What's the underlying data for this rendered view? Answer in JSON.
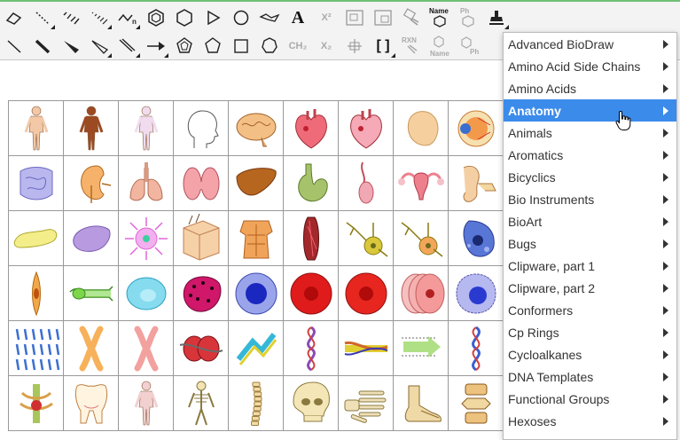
{
  "toolbar": {
    "text_tool": "A",
    "superscript": "X²",
    "subscript": "X₂",
    "ch2_label": "CH₂",
    "brackets_label": "[ ]",
    "rxn_label": "RXN",
    "name_label": "Name",
    "ph_label": "Ph",
    "name_label_2": "Name",
    "ph_label_2": "Ph"
  },
  "template_menu": {
    "items": [
      {
        "label": "Advanced BioDraw"
      },
      {
        "label": "Amino Acid Side Chains"
      },
      {
        "label": "Amino Acids"
      },
      {
        "label": "Anatomy"
      },
      {
        "label": "Animals"
      },
      {
        "label": "Aromatics"
      },
      {
        "label": "Bicyclics"
      },
      {
        "label": "Bio Instruments"
      },
      {
        "label": "BioArt"
      },
      {
        "label": "Bugs"
      },
      {
        "label": "Clipware, part 1"
      },
      {
        "label": "Clipware, part 2"
      },
      {
        "label": "Conformers"
      },
      {
        "label": "Cp Rings"
      },
      {
        "label": "Cycloalkanes"
      },
      {
        "label": "DNA Templates"
      },
      {
        "label": "Functional Groups"
      },
      {
        "label": "Hexoses"
      }
    ],
    "active_index": 3
  },
  "anatomy_grid": {
    "cells": [
      {
        "name": "male-body",
        "shape": "body",
        "color": "#f2c8a6"
      },
      {
        "name": "male-muscle-body",
        "shape": "body",
        "color": "#9b4a22"
      },
      {
        "name": "female-body",
        "shape": "body",
        "color": "#f0dcee"
      },
      {
        "name": "head-outline",
        "shape": "head",
        "color": "#ffffff"
      },
      {
        "name": "brain",
        "shape": "brain",
        "color": "#f4bf84"
      },
      {
        "name": "heart-red",
        "shape": "heart",
        "color": "#ef6b7a"
      },
      {
        "name": "heart-pink",
        "shape": "heart",
        "color": "#f6a9b6"
      },
      {
        "name": "pancreas-organ",
        "shape": "blob",
        "color": "#f5cf9d"
      },
      {
        "name": "eye",
        "shape": "eye",
        "color": "#f3a55a"
      },
      {
        "name": "intestines",
        "shape": "intestine",
        "color": "#b9b7ee"
      },
      {
        "name": "kidney",
        "shape": "kidney",
        "color": "#f6b26b"
      },
      {
        "name": "lungs",
        "shape": "lungs",
        "color": "#f2b5a0"
      },
      {
        "name": "thyroid",
        "shape": "thyroid",
        "color": "#f4a3a8"
      },
      {
        "name": "liver",
        "shape": "liver",
        "color": "#b6661f"
      },
      {
        "name": "stomach",
        "shape": "stomach",
        "color": "#a6c26a"
      },
      {
        "name": "testis",
        "shape": "testis",
        "color": "#f0a8b4"
      },
      {
        "name": "uterus",
        "shape": "uterus",
        "color": "#ee7f8c"
      },
      {
        "name": "ear",
        "shape": "ear",
        "color": "#f5cfa4"
      },
      {
        "name": "pancreas",
        "shape": "pancreas",
        "color": "#f3ee8a"
      },
      {
        "name": "spleen",
        "shape": "spleen",
        "color": "#b89ae0"
      },
      {
        "name": "mast-cell",
        "shape": "spiky",
        "color": "#e066d8"
      },
      {
        "name": "skin-section",
        "shape": "skin",
        "color": "#f6d1a8"
      },
      {
        "name": "torso-muscles",
        "shape": "torso",
        "color": "#f0a45a"
      },
      {
        "name": "muscle-fiber",
        "shape": "muscle",
        "color": "#a3282c"
      },
      {
        "name": "neuron",
        "shape": "neuron",
        "color": "#d8c83a"
      },
      {
        "name": "neuron-orange",
        "shape": "neuron",
        "color": "#f3a65a"
      },
      {
        "name": "secretory-cell",
        "shape": "secretory",
        "color": "#5876d6"
      },
      {
        "name": "fibroblast",
        "shape": "spindle",
        "color": "#f2a84a"
      },
      {
        "name": "nerve-cell-green",
        "shape": "rod",
        "color": "#7dd64a"
      },
      {
        "name": "epithelial-cell",
        "shape": "oval",
        "color": "#86dbef"
      },
      {
        "name": "dotted-cell",
        "shape": "dotted",
        "color": "#d0176a"
      },
      {
        "name": "blue-cell",
        "shape": "nucleus",
        "color": "#5a6fe0"
      },
      {
        "name": "red-cell",
        "shape": "redcell",
        "color": "#e01b1b"
      },
      {
        "name": "red-cell-2",
        "shape": "redcell",
        "color": "#e7261f"
      },
      {
        "name": "red-blood-cells",
        "shape": "stack",
        "color": "#f49a9a"
      },
      {
        "name": "lymphocyte",
        "shape": "lymph",
        "color": "#b6b8f0"
      },
      {
        "name": "karyotype",
        "shape": "karyotype",
        "color": "#3c6fd1"
      },
      {
        "name": "chromosome-orange",
        "shape": "chromosome",
        "color": "#f7b15a"
      },
      {
        "name": "chromosome-pink",
        "shape": "chromosome",
        "color": "#f2a19e"
      },
      {
        "name": "nucleosome",
        "shape": "nucleosome",
        "color": "#d7353a"
      },
      {
        "name": "dna-ribbon",
        "shape": "ribbon",
        "color": "#35b8d8"
      },
      {
        "name": "dna-helix",
        "shape": "helix",
        "color": "#8a4ab4"
      },
      {
        "name": "dna-strand",
        "shape": "strand",
        "color": "#d1662b"
      },
      {
        "name": "transcription",
        "shape": "arrows",
        "color": "#9bd866"
      },
      {
        "name": "dna-blue",
        "shape": "helix",
        "color": "#3a5fd0"
      },
      {
        "name": "skeleton-torso",
        "shape": "spine",
        "color": "#a9c65a"
      },
      {
        "name": "tooth",
        "shape": "tooth",
        "color": "#ecc08a"
      },
      {
        "name": "circulatory-body",
        "shape": "body",
        "color": "#f2d0d0"
      },
      {
        "name": "skeleton",
        "shape": "skeleton",
        "color": "#f1e3b3"
      },
      {
        "name": "spine",
        "shape": "spinecol",
        "color": "#f3dba6"
      },
      {
        "name": "skull",
        "shape": "skull",
        "color": "#f4e6b6"
      },
      {
        "name": "hand-bones",
        "shape": "hand",
        "color": "#efe0b8"
      },
      {
        "name": "foot-bones",
        "shape": "foot",
        "color": "#efd9a6"
      },
      {
        "name": "vertebra",
        "shape": "vertebra",
        "color": "#ecc27e"
      }
    ]
  }
}
